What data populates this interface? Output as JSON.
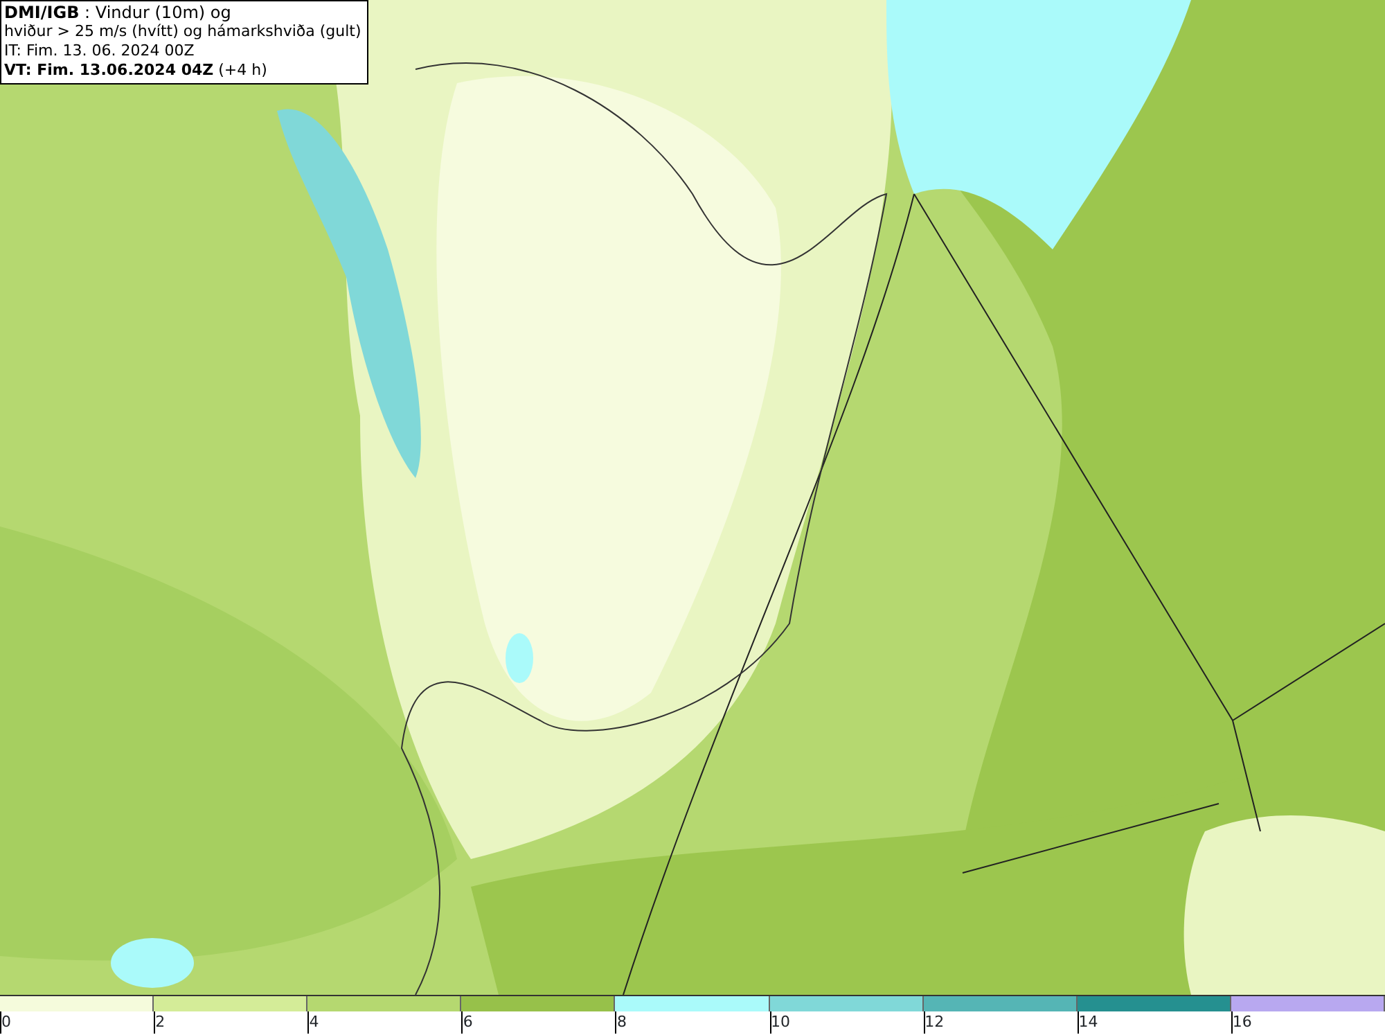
{
  "title_box": {
    "lines": [
      "**DMI/IGB** : Vindur (10m) og",
      "hviður > 25 m/s (hvítt) og hámarkshviða (gult)",
      "IT: Fim. 13. 06. 2024 00Z",
      "**VT: Fim. 13.06.2024 04Z** (+4 h)"
    ]
  },
  "legend": [
    {
      "label": "0",
      "color": "#f5fbdc"
    },
    {
      "label": "2",
      "color": "#d4ec98"
    },
    {
      "label": "4",
      "color": "#b5d870"
    },
    {
      "label": "6",
      "color": "#97c14a"
    },
    {
      "label": "8",
      "color": "#aafafa"
    },
    {
      "label": "10",
      "color": "#80d8d8"
    },
    {
      "label": "12",
      "color": "#55b5b5"
    },
    {
      "label": "14",
      "color": "#259090"
    },
    {
      "label": "16",
      "color": "#b8a8f0"
    }
  ]
}
